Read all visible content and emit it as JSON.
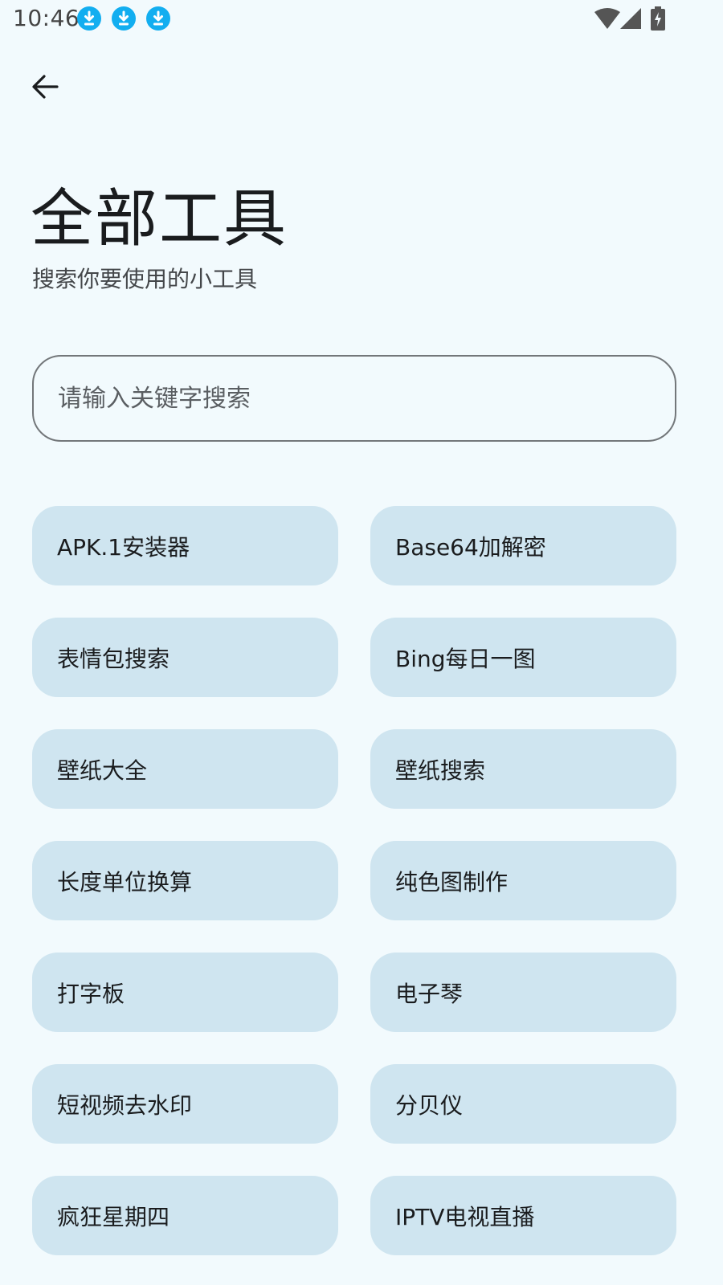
{
  "status_bar": {
    "time": "10:46",
    "notification_icons": [
      "download-icon",
      "download-icon",
      "download-icon"
    ],
    "right_icons": [
      "wifi-icon",
      "signal-icon",
      "battery-charging-icon"
    ],
    "accent_color": "#12aef0"
  },
  "header": {
    "back_icon": "arrow-left-icon",
    "title": "全部工具",
    "subtitle": "搜索你要使用的小工具"
  },
  "search": {
    "placeholder": "请输入关键字搜索",
    "value": ""
  },
  "tools": [
    {
      "label": "APK.1安装器"
    },
    {
      "label": "Base64加解密"
    },
    {
      "label": "表情包搜索"
    },
    {
      "label": "Bing每日一图"
    },
    {
      "label": "壁纸大全"
    },
    {
      "label": "壁纸搜索"
    },
    {
      "label": "长度单位换算"
    },
    {
      "label": "纯色图制作"
    },
    {
      "label": "打字板"
    },
    {
      "label": "电子琴"
    },
    {
      "label": "短视频去水印"
    },
    {
      "label": "分贝仪"
    },
    {
      "label": "疯狂星期四"
    },
    {
      "label": "IPTV电视直播"
    }
  ],
  "colors": {
    "background": "#f2fafd",
    "card": "#cfe5f0",
    "outline": "#73777a"
  }
}
